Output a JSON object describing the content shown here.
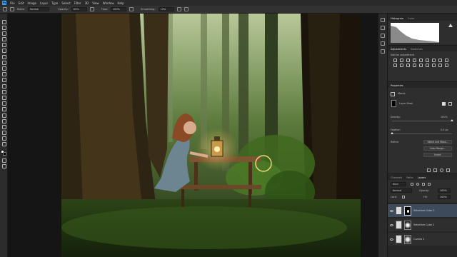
{
  "menubar": {
    "logo": "Ps",
    "items": [
      "File",
      "Edit",
      "Image",
      "Layer",
      "Type",
      "Select",
      "Filter",
      "3D",
      "View",
      "Window",
      "Help"
    ]
  },
  "options": {
    "mode_label": "Mode:",
    "mode_value": "Normal",
    "opacity_label": "Opacity:",
    "opacity_value": "65%",
    "flow_label": "Flow:",
    "flow_value": "100%",
    "smoothing_label": "Smoothing:",
    "smoothing_value": "10%"
  },
  "panels": {
    "histogram": {
      "tabs": [
        "Histogram",
        "Color"
      ]
    },
    "adjustments": {
      "tabs": [
        "Adjustments",
        "Swatches"
      ],
      "title": "Add an adjustment"
    },
    "properties": {
      "tab": "Properties",
      "title": "Masks",
      "layer_mask": "Layer Mask",
      "density_label": "Density:",
      "density_value": "100%",
      "feather_label": "Feather:",
      "feather_value": "0.0 px",
      "refine_label": "Refine:",
      "btn_select_mask": "Select and Mask...",
      "btn_color_range": "Color Range...",
      "btn_invert": "Invert"
    },
    "layers": {
      "tabs": [
        "Channels",
        "Paths",
        "Layers"
      ],
      "kind_label": "Kind",
      "blend": "Normal",
      "opacity_label": "Opacity:",
      "opacity_value": "100%",
      "lock_label": "Lock:",
      "fill_label": "Fill:",
      "fill_value": "100%",
      "items": [
        {
          "name": "Selective Color 2",
          "selected": true
        },
        {
          "name": "Selective Color 1",
          "selected": false
        },
        {
          "name": "Curves 1",
          "selected": false
        }
      ]
    }
  },
  "colors": {
    "accent": "#31a8ff",
    "selected_layer": "#3d4a5c",
    "panel": "#2e2e2e"
  }
}
